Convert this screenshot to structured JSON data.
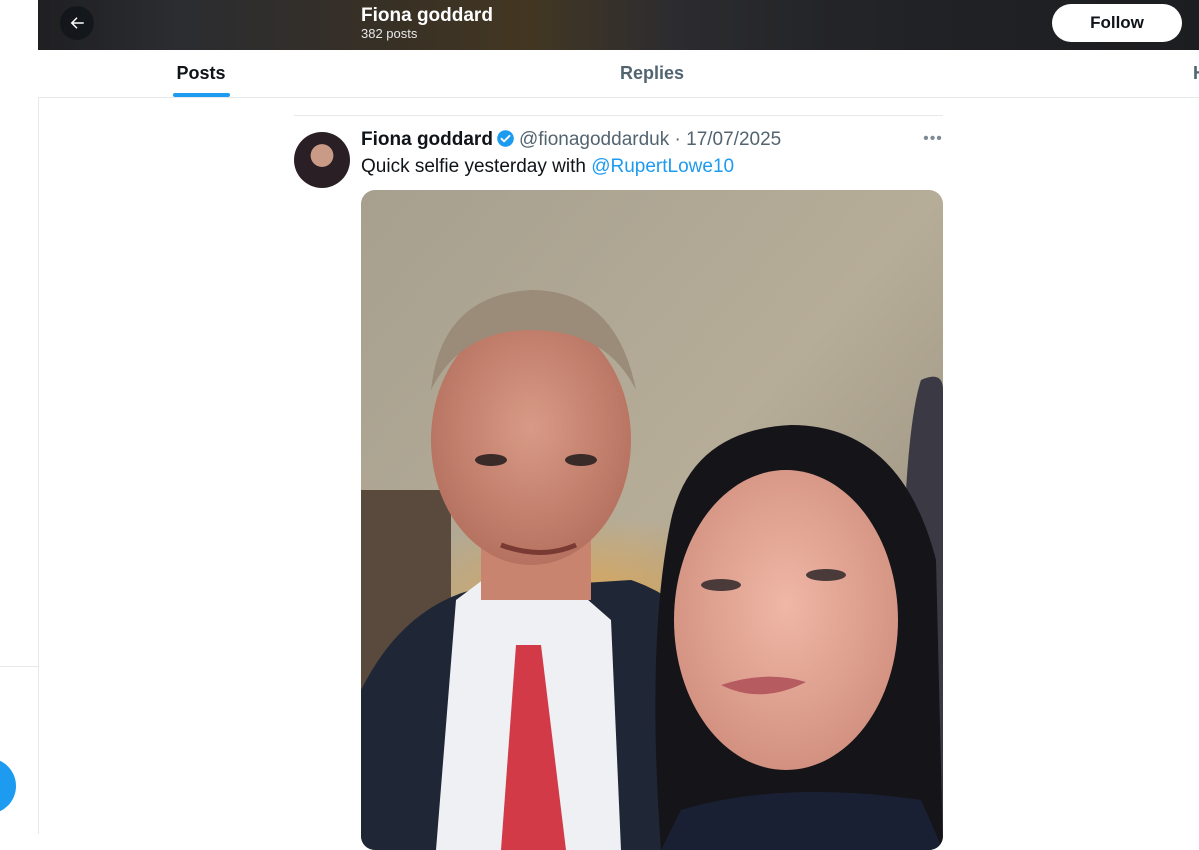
{
  "header": {
    "back_icon": "arrow-left-icon",
    "profile_name": "Fiona goddard",
    "post_count": "382 posts",
    "follow_label": "Follow"
  },
  "tabs": [
    {
      "label": "Posts",
      "selected": true
    },
    {
      "label": "Replies",
      "selected": false
    },
    {
      "label": "H",
      "selected": false
    }
  ],
  "tweet": {
    "display_name": "Fiona goddard",
    "verified_icon": "verified-badge-icon",
    "handle": "@fionagoddarduk",
    "separator": "·",
    "date": "17/07/2025",
    "more_icon": "more-horizontal-icon",
    "text_prefix": "Quick selfie yesterday with ",
    "mention": "@RupertLowe10",
    "media_alt": "selfie photo"
  },
  "colors": {
    "accent": "#1d9bf0",
    "secondary_text": "#536471",
    "primary_text": "#0f1419"
  }
}
